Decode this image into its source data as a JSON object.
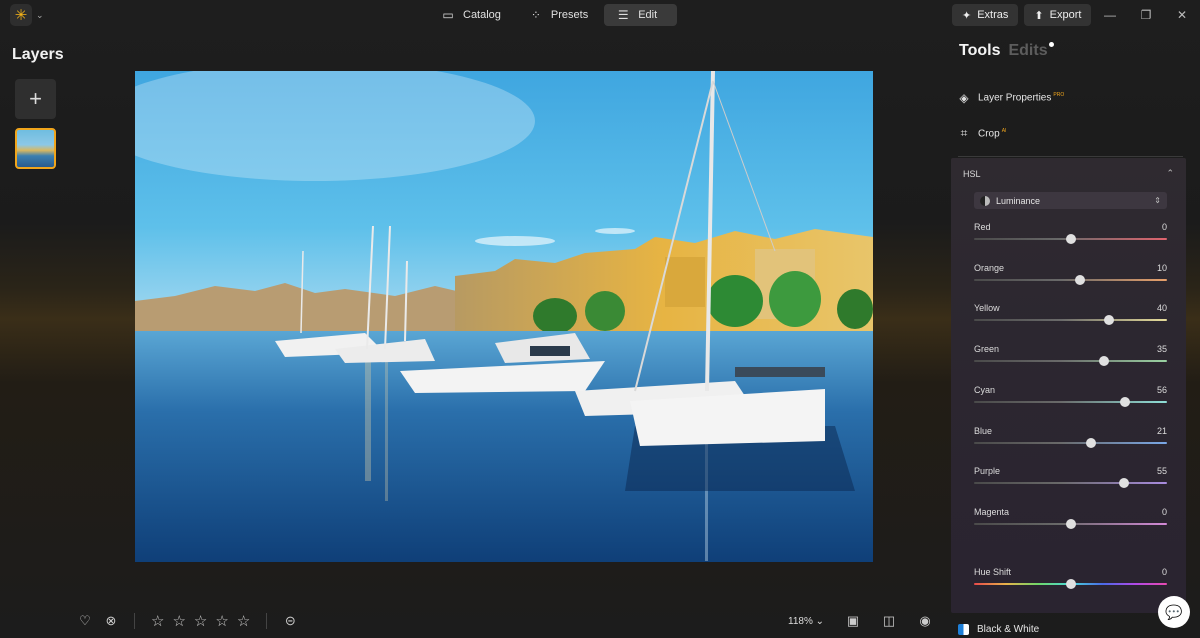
{
  "topbar": {
    "modes": [
      {
        "label": "Catalog",
        "icon": "folder-icon"
      },
      {
        "label": "Presets",
        "icon": "magic-wand-icon"
      },
      {
        "label": "Edit",
        "icon": "sliders-icon",
        "active": true
      }
    ],
    "extras_label": "Extras",
    "export_label": "Export"
  },
  "layers": {
    "title": "Layers"
  },
  "bottom_bar": {
    "zoom": "118%",
    "rating_stars": 5
  },
  "panel": {
    "tabs": {
      "tools": "Tools",
      "edits": "Edits"
    },
    "layer_properties": {
      "label": "Layer Properties",
      "badge": "PRO"
    },
    "crop": {
      "label": "Crop",
      "badge": "AI"
    },
    "hsl": {
      "title": "HSL",
      "mode": "Luminance",
      "sliders": [
        {
          "label": "Red",
          "value": "0"
        },
        {
          "label": "Orange",
          "value": "10"
        },
        {
          "label": "Yellow",
          "value": "40"
        },
        {
          "label": "Green",
          "value": "35"
        },
        {
          "label": "Cyan",
          "value": "56"
        },
        {
          "label": "Blue",
          "value": "21"
        },
        {
          "label": "Purple",
          "value": "55"
        },
        {
          "label": "Magenta",
          "value": "0"
        }
      ],
      "hue_shift": {
        "label": "Hue Shift",
        "value": "0"
      }
    },
    "black_white": "Black & White"
  },
  "colors": {
    "accent": "#f0a51c",
    "red": "#e0646e",
    "orange": "#e8a06a",
    "yellow": "#e6dc9a",
    "green": "#9ad2a2",
    "cyan": "#8fe0d8",
    "blue": "#7aa8e8",
    "purple": "#a98ce0",
    "magenta": "#d48ad8"
  }
}
